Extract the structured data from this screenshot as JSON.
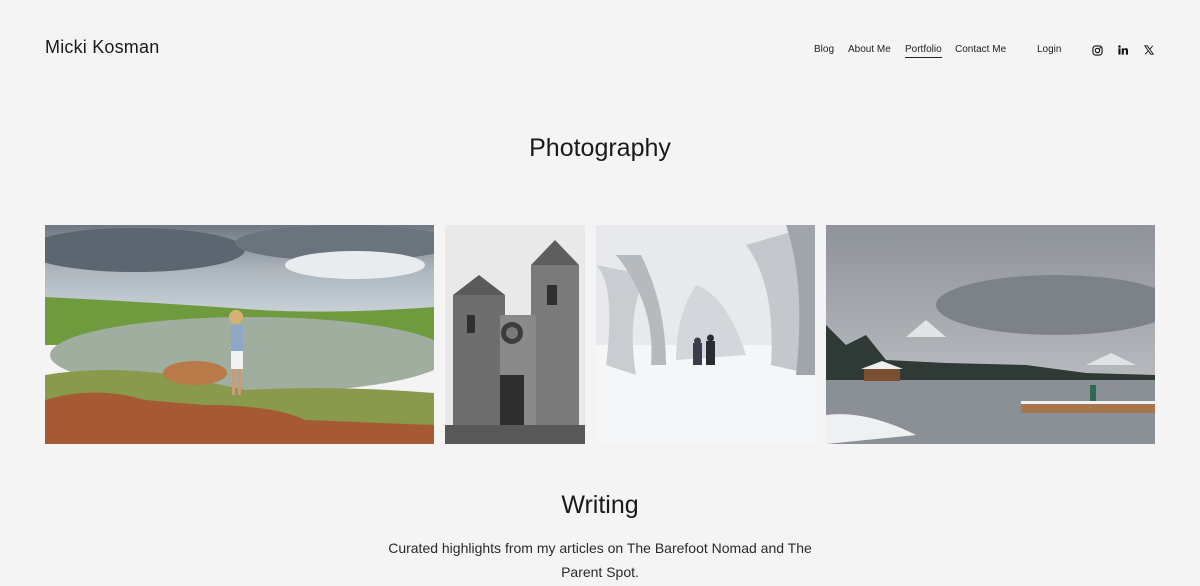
{
  "site": {
    "title": "Micki Kosman"
  },
  "nav": {
    "items": [
      {
        "label": "Blog"
      },
      {
        "label": "About Me"
      },
      {
        "label": "Portfolio",
        "active": true
      },
      {
        "label": "Contact Me"
      }
    ],
    "login_label": "Login",
    "social_icons": [
      "instagram-icon",
      "linkedin-icon",
      "x-icon"
    ]
  },
  "photography": {
    "heading": "Photography"
  },
  "writing": {
    "heading": "Writing",
    "description": "Curated highlights from my articles on The Barefoot Nomad and The Parent Spot."
  },
  "colors": {
    "background": "#f4f4f4",
    "text": "#1a1a1a"
  }
}
